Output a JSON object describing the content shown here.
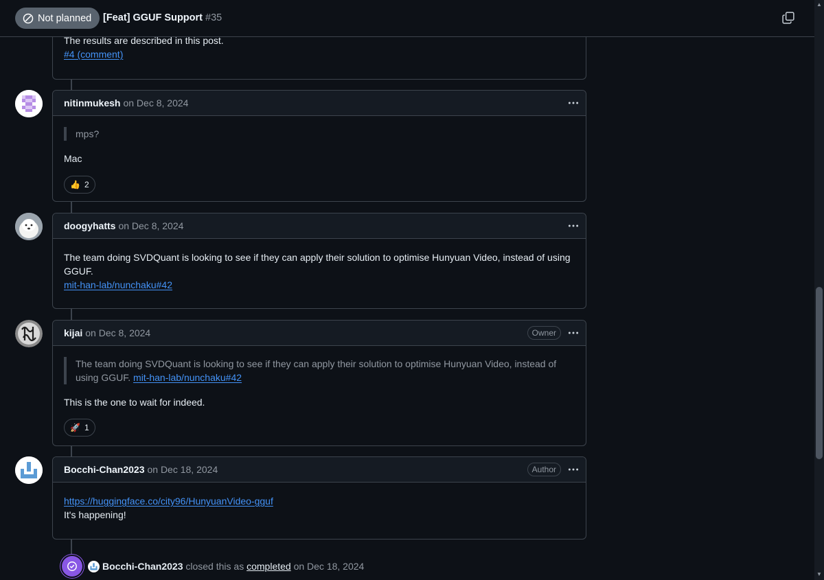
{
  "header": {
    "state_label": "Not planned",
    "title": "[Feat] GGUF Support",
    "number": "#35"
  },
  "first_comment": {
    "text": "The results are described in this post.",
    "link": "#4 (comment)"
  },
  "comments": [
    {
      "author": "nitinmukesh",
      "date": "on Dec 8, 2024",
      "quote": "mps?",
      "text": "Mac",
      "reaction_emoji": "👍",
      "reaction_count": "2"
    },
    {
      "author": "doogyhatts",
      "date": "on Dec 8, 2024",
      "text": "The team doing SVDQuant is looking to see if they can apply their solution to optimise Hunyuan Video, instead of using GGUF.",
      "link": "mit-han-lab/nunchaku#42"
    },
    {
      "author": "kijai",
      "date": "on Dec 8, 2024",
      "badge": "Owner",
      "quote": "The team doing SVDQuant is looking to see if they can apply their solution to optimise Hunyuan Video, instead of using GGUF.",
      "quote_link": "mit-han-lab/nunchaku#42",
      "text": "This is the one to wait for indeed.",
      "reaction_emoji": "🚀",
      "reaction_count": "1"
    },
    {
      "author": "Bocchi-Chan2023",
      "date": "on Dec 18, 2024",
      "badge": "Author",
      "link": "https://huggingface.co/city96/HunyuanVideo-gguf",
      "text": "It's happening!"
    }
  ],
  "event": {
    "actor": "Bocchi-Chan2023",
    "action": "closed this as",
    "state": "completed",
    "date": "on Dec 18, 2024"
  },
  "colors": {
    "background": "#0d1117",
    "border": "#3d444d",
    "link": "#4493f8",
    "closed_purple": "#8957e5",
    "muted": "#9198a1"
  }
}
